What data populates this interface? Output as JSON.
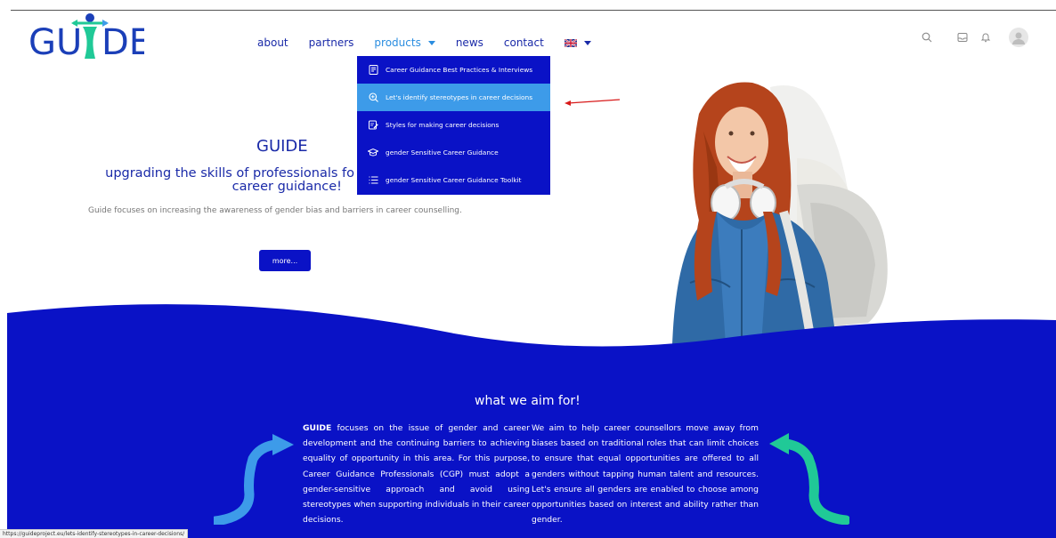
{
  "logo": {
    "text": "GUIDE"
  },
  "nav": {
    "items": [
      "about",
      "partners",
      "products",
      "news",
      "contact"
    ],
    "language_flag": "uk-flag-icon"
  },
  "header_icons": [
    "search-icon",
    "inbox-icon",
    "bell-icon",
    "user-avatar"
  ],
  "dropdown": {
    "items": [
      {
        "label": "Career Guidance Best Practices & Interviews",
        "icon": "book-icon"
      },
      {
        "label": "Let's identify stereotypes in career decisions",
        "icon": "zoom-icon",
        "highlighted": true
      },
      {
        "label": "Styles for making career decisions",
        "icon": "edit-icon"
      },
      {
        "label": "gender Sensitive Career Guidance",
        "icon": "graduation-cap-icon"
      },
      {
        "label": "gender Sensitive Career Guidance Toolkit",
        "icon": "list-icon"
      }
    ]
  },
  "hero": {
    "title": "GUIDE",
    "subtitle_line1": "upgrading the skills of professionals fo",
    "subtitle_line2": "career guidance!",
    "description": "Guide focuses on increasing the awareness of gender bias and barriers in career counselling.",
    "button": "more..."
  },
  "aim": {
    "title": "what we aim for!",
    "col1_bold": "GUIDE",
    "col1_text": " focuses on the issue of gender and career development and the continuing barriers to achieving equality of opportunity in this area. For this purpose, Career Guidance Professionals (CGP) must adopt a gender-sensitive approach and avoid using stereotypes when supporting individuals in their career decisions.",
    "col2_text": "We aim to help career counsellors move away from biases based on traditional roles that can limit choices to ensure that equal opportunities are offered to all genders without tapping human talent and resources. Let's ensure all genders are enabled to choose among opportunities based on interest and ability rather than gender."
  },
  "status_url": "https://guideproject.eu/lets-identify-stereotypes-in-career-decisions/",
  "colors": {
    "primary": "#0a12c6",
    "highlight": "#3d9be9",
    "green": "#20c997"
  }
}
